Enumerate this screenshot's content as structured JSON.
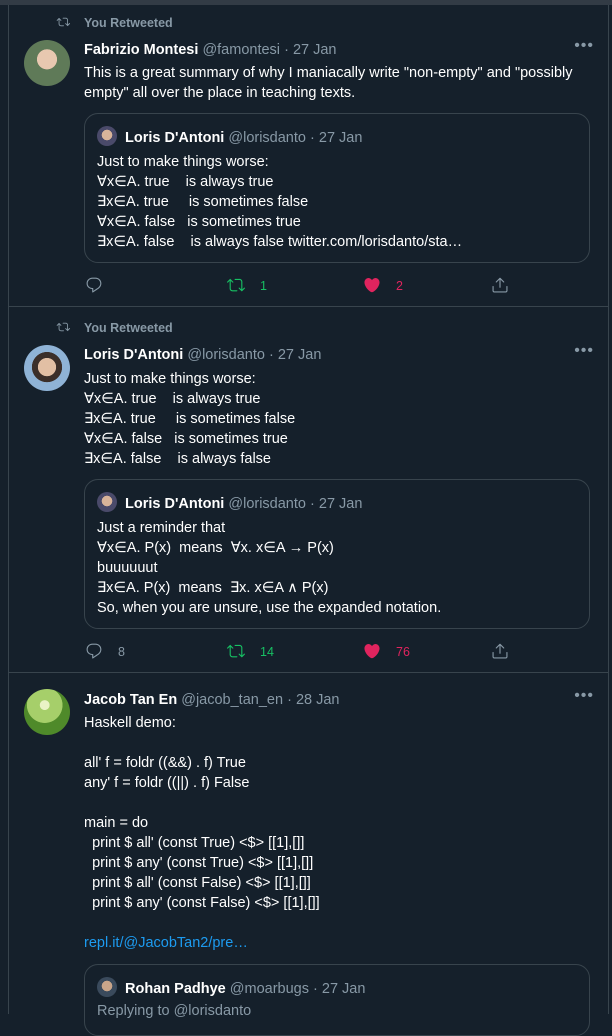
{
  "tweets": [
    {
      "retweet_label": "You Retweeted",
      "name": "Fabrizio Montesi",
      "handle": "@famontesi",
      "dot": "·",
      "time": "27 Jan",
      "more": "•••",
      "text": "This is a great summary of why I maniacally write \"non-empty\" and \"possibly empty\" all over the place in teaching texts.",
      "quote": {
        "name": "Loris D'Antoni",
        "handle": "@lorisdanto",
        "dot": "·",
        "time": "27 Jan",
        "text": "Just to make things worse:\n∀x∈A. true    is always true\n∃x∈A. true     is sometimes false\n∀x∈A. false   is sometimes true\n∃x∈A. false    is always false twitter.com/lorisdanto/sta…"
      },
      "replies": "",
      "retweets": "1",
      "likes": "2"
    },
    {
      "retweet_label": "You Retweeted",
      "name": "Loris D'Antoni",
      "handle": "@lorisdanto",
      "dot": "·",
      "time": "27 Jan",
      "more": "•••",
      "text": "Just to make things worse:\n∀x∈A. true    is always true\n∃x∈A. true     is sometimes false\n∀x∈A. false   is sometimes true\n∃x∈A. false    is always false",
      "quote": {
        "name": "Loris D'Antoni",
        "handle": "@lorisdanto",
        "dot": "·",
        "time": "27 Jan",
        "text": "Just a reminder that\n∀x∈A. P(x)  means  ∀x. x∈A → P(x)\nbuuuuuut\n∃x∈A. P(x)  means  ∃x. x∈A ∧ P(x)\nSo, when you are unsure, use the expanded notation."
      },
      "replies": "8",
      "retweets": "14",
      "likes": "76"
    },
    {
      "name": "Jacob Tan En",
      "handle": "@jacob_tan_en",
      "dot": "·",
      "time": "28 Jan",
      "more": "•••",
      "text": "Haskell demo:\n\nall' f = foldr ((&&) . f) True\nany' f = foldr ((||) . f) False\n\nmain = do\n  print $ all' (const True) <$> [[1],[]]\n  print $ any' (const True) <$> [[1],[]]\n  print $ all' (const False) <$> [[1],[]]\n  print $ any' (const False) <$> [[1],[]]",
      "link": "repl.it/@JacobTan2/pre…",
      "quote": {
        "name": "Rohan Padhye",
        "handle": "@moarbugs",
        "dot": "·",
        "time": "27 Jan",
        "text": "Replying to @lorisdanto"
      }
    }
  ],
  "colors": {
    "retweet": "#17bf63",
    "like": "#e0245e",
    "muted": "#8899a6",
    "link": "#1d9bf0"
  },
  "icons": [
    "retweet-icon",
    "reply-icon",
    "heart-icon",
    "share-icon",
    "more-icon"
  ]
}
